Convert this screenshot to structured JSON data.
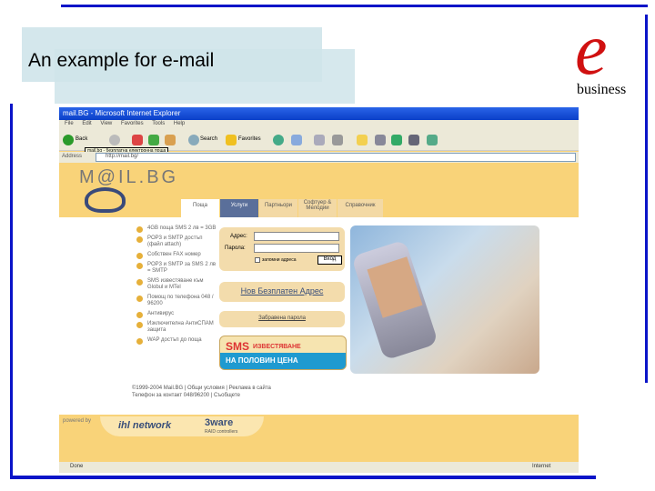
{
  "slide": {
    "title": "An example for e-mail",
    "logo_letter": "e",
    "logo_word": "business"
  },
  "browser": {
    "window_title": "mail.BG - Microsoft Internet Explorer",
    "menu": [
      "File",
      "Edit",
      "View",
      "Favorites",
      "Tools",
      "Help"
    ],
    "toolbar": {
      "back": "Back",
      "search": "Search",
      "favorites": "Favorites"
    },
    "tooltip": "mail.bg - безплатна електронна поща",
    "address_label": "Address",
    "address_value": "http://mail.bg/",
    "status_left": "Done",
    "status_right": "Internet"
  },
  "site": {
    "logo": "M@IL.BG",
    "tabs": [
      "Поща",
      "Услуги",
      "Партньори",
      "Софтуер & Мелодии",
      "Справочник"
    ],
    "nav": [
      "4GB поща SMS 2 лв = 3GB",
      "POP3 и SMTP достъп (файл attach)",
      "Собствен FAX номер",
      "POP3 и SMTP за SMS 2 лв = SMTP",
      "SMS известяване към Globul и MTel",
      "Помощ по телефона 048 / 96200",
      "Антивирус",
      "Изключителна АнтиСПАМ защита",
      "WAP достъп до поща"
    ],
    "login": {
      "address_label": "Адрес:",
      "password_label": "Парола:",
      "remember": "запомни адреса",
      "submit": "Вход"
    },
    "new_address": "Нов Безплатен Адрес",
    "forgot": "Забравена парола",
    "sms_banner": {
      "line1": "SMS",
      "line1b": "ИЗВЕСТЯВАНЕ",
      "line2": "НА ПОЛОВИН ЦЕНА"
    },
    "footer": [
      "©1999-2004 Mail.BG | Общи условия | Реклама в сайта",
      "Телефон за контакт 048/96200 | Съобщете"
    ],
    "powered_by": "powered by",
    "sponsor1": "ihl network",
    "sponsor2": "3ware",
    "sponsor2_sub": "RAID controllers"
  }
}
